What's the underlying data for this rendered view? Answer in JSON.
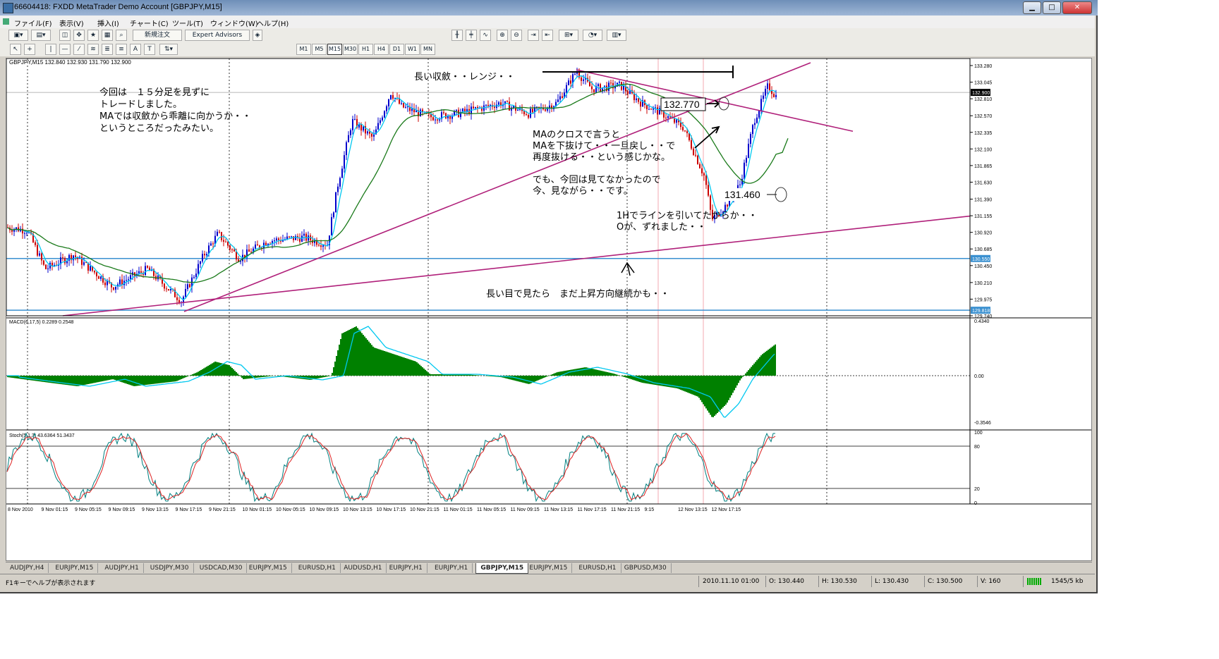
{
  "window": {
    "title": "66604418: FXDD   MetaTrader   Demo Account   [GBPJPY,M15]"
  },
  "menu": [
    "ファイル(F)",
    "表示(V)",
    "挿入(I)",
    "チャート(C)",
    "ツール(T)",
    "ウィンドウ(W)",
    "ヘルプ(H)"
  ],
  "toolbar": {
    "new_order": "新規注文",
    "expert_advisors": "Expert Advisors"
  },
  "timeframes": [
    "M1",
    "M5",
    "M15",
    "M30",
    "H1",
    "H4",
    "D1",
    "W1",
    "MN"
  ],
  "active_timeframe": "M15",
  "chart_header": "GBPJPY,M15  132.840 132.930 131.790 132.900",
  "price_axis": [
    "133.280",
    "133.045",
    "132.810",
    "132.570",
    "132.335",
    "132.100",
    "131.865",
    "131.630",
    "131.390",
    "131.155",
    "130.920",
    "130.685",
    "130.450",
    "130.210",
    "129.975",
    "129.740"
  ],
  "price_marks": {
    "current": "132.900",
    "blue_line1": "130.550",
    "blue_line2": "129.818"
  },
  "macd": {
    "label": "MACD(6,17,5) 0.2289 0.2548",
    "axis": [
      "0.4340",
      "0.00",
      "-0.3546"
    ]
  },
  "stoch": {
    "label": "Stoch(5,1,3) 43.6364 51.3437",
    "axis": [
      "100",
      "80",
      "20",
      "0"
    ]
  },
  "time_axis": [
    "8 Nov 2010",
    "9 Nov 01:15",
    "9 Nov 05:15",
    "9 Nov 09:15",
    "9 Nov 13:15",
    "9 Nov 17:15",
    "9 Nov 21:15",
    "10 Nov 01:15",
    "10 Nov 05:15",
    "10 Nov 09:15",
    "10 Nov 13:15",
    "10 Nov 17:15",
    "10 Nov 21:15",
    "11 Nov 01:15",
    "11 Nov 05:15",
    "11 Nov 09:15",
    "11 Nov 13:15",
    "11 Nov 17:15",
    "11 Nov 21:15",
    "9:15",
    "12 Nov 13:15",
    "12 Nov 17:15"
  ],
  "annotations": {
    "note1": [
      "今回は　１５分足を見ずに",
      "トレードしました。",
      "MAでは収斂から乖離に向かうか・・",
      "というところだったみたい。"
    ],
    "note2": "長い収斂・・レンジ・・",
    "note3": [
      "MAのクロスで言うと",
      "MAを下抜けて・・一旦戻し・・で",
      "再度抜ける・・という感じかな。"
    ],
    "note4": [
      "でも、今回は見てなかったので",
      "今、見ながら・・です。"
    ],
    "note5": [
      "1Hでラインを引いてたからか・・",
      "Oが、ずれました・・"
    ],
    "note6": "長い目で見たら　まだ上昇方向継続かも・・",
    "price_label1": "132.770",
    "price_label2": "131.460"
  },
  "tabs": [
    "AUDJPY,H4",
    "EURJPY,M15",
    "AUDJPY,H1",
    "USDJPY,M30",
    "USDCAD,M30",
    "EURJPY,M15",
    "EURUSD,H1",
    "AUDUSD,H1",
    "EURJPY,H1",
    "EURJPY,H1",
    "GBPJPY,M15",
    "EURJPY,M15",
    "EURUSD,H1",
    "GBPUSD,M30"
  ],
  "active_tab": "GBPJPY,M15",
  "status": {
    "help": "F1キーでヘルプが表示されます",
    "time": "2010.11.10 01:00",
    "open": "O: 130.440",
    "high": "H: 130.530",
    "low": "L: 130.430",
    "close": "C: 130.500",
    "volume": "V: 160",
    "traffic": "1545/5 kb"
  },
  "colors": {
    "bull": "#0000cc",
    "bear": "#cc0000",
    "ma_fast": "#00c8f0",
    "ma_slow": "#1a7a1a",
    "trendline": "#b0207a",
    "hline": "#3a90d0",
    "macd_hist": "#008000",
    "stoch_main": "#008080",
    "stoch_signal": "#dd2222"
  }
}
